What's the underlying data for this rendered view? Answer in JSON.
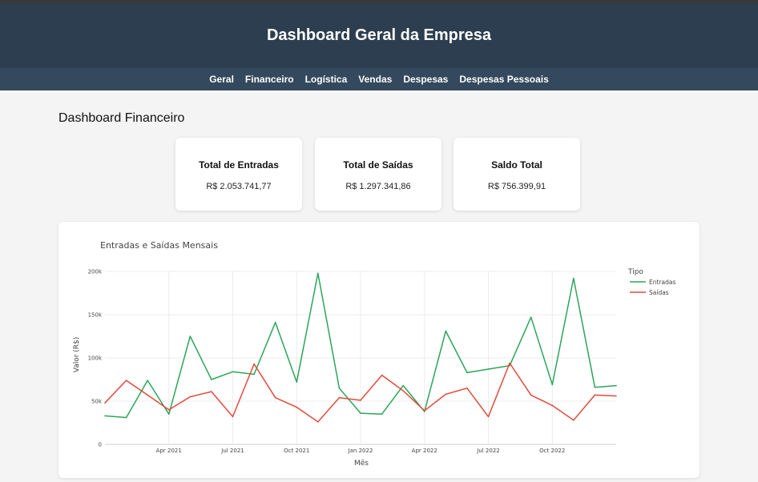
{
  "header": {
    "title": "Dashboard Geral da Empresa"
  },
  "nav": {
    "items": [
      "Geral",
      "Financeiro",
      "Logística",
      "Vendas",
      "Despesas",
      "Despesas Pessoais"
    ]
  },
  "page": {
    "title": "Dashboard Financeiro"
  },
  "cards": [
    {
      "title": "Total de Entradas",
      "value": "R$ 2.053.741,77"
    },
    {
      "title": "Total de Saídas",
      "value": "R$ 1.297.341,86"
    },
    {
      "title": "Saldo Total",
      "value": "R$ 756.399,91"
    }
  ],
  "colors": {
    "entradas": "#2ca55a",
    "saidas": "#e04b3c",
    "header": "#2c3e50",
    "nav": "#34495e"
  },
  "chart_data": {
    "type": "line",
    "title": "Entradas e Saídas Mensais",
    "xlabel": "Mês",
    "ylabel": "Valor (R$)",
    "legend_title": "Tipo",
    "legend_position": "top-right",
    "grid": true,
    "ylim": [
      0,
      200000
    ],
    "y_ticks": [
      0,
      50000,
      100000,
      150000,
      200000
    ],
    "y_tick_labels": [
      "0",
      "50k",
      "100k",
      "150k",
      "200k"
    ],
    "x_tick_labels": [
      "Apr 2021",
      "Jul 2021",
      "Oct 2021",
      "Jan 2022",
      "Apr 2022",
      "Jul 2022",
      "Oct 2022"
    ],
    "x_tick_dates": [
      "2021-04",
      "2021-07",
      "2021-10",
      "2022-01",
      "2022-04",
      "2022-07",
      "2022-10"
    ],
    "x": [
      "2021-01",
      "2021-02",
      "2021-03",
      "2021-04",
      "2021-05",
      "2021-06",
      "2021-07",
      "2021-08",
      "2021-09",
      "2021-10",
      "2021-11",
      "2021-12",
      "2022-01",
      "2022-02",
      "2022-03",
      "2022-04",
      "2022-05",
      "2022-06",
      "2022-07",
      "2022-08",
      "2022-09",
      "2022-10",
      "2022-11",
      "2022-12",
      "2023-01"
    ],
    "series": [
      {
        "name": "Entradas",
        "values": [
          33000,
          31000,
          74000,
          35000,
          125000,
          75000,
          84000,
          81000,
          141000,
          72000,
          198000,
          65000,
          36000,
          35000,
          68000,
          38000,
          131000,
          83000,
          87000,
          91000,
          147000,
          69000,
          192000,
          66000,
          68000
        ]
      },
      {
        "name": "Saídas",
        "values": [
          48000,
          74000,
          57000,
          40000,
          55000,
          61000,
          32000,
          93000,
          54000,
          43000,
          26000,
          54000,
          51000,
          80000,
          62000,
          39000,
          58000,
          65000,
          32000,
          94000,
          57000,
          45000,
          28000,
          57000,
          56000
        ]
      }
    ]
  }
}
